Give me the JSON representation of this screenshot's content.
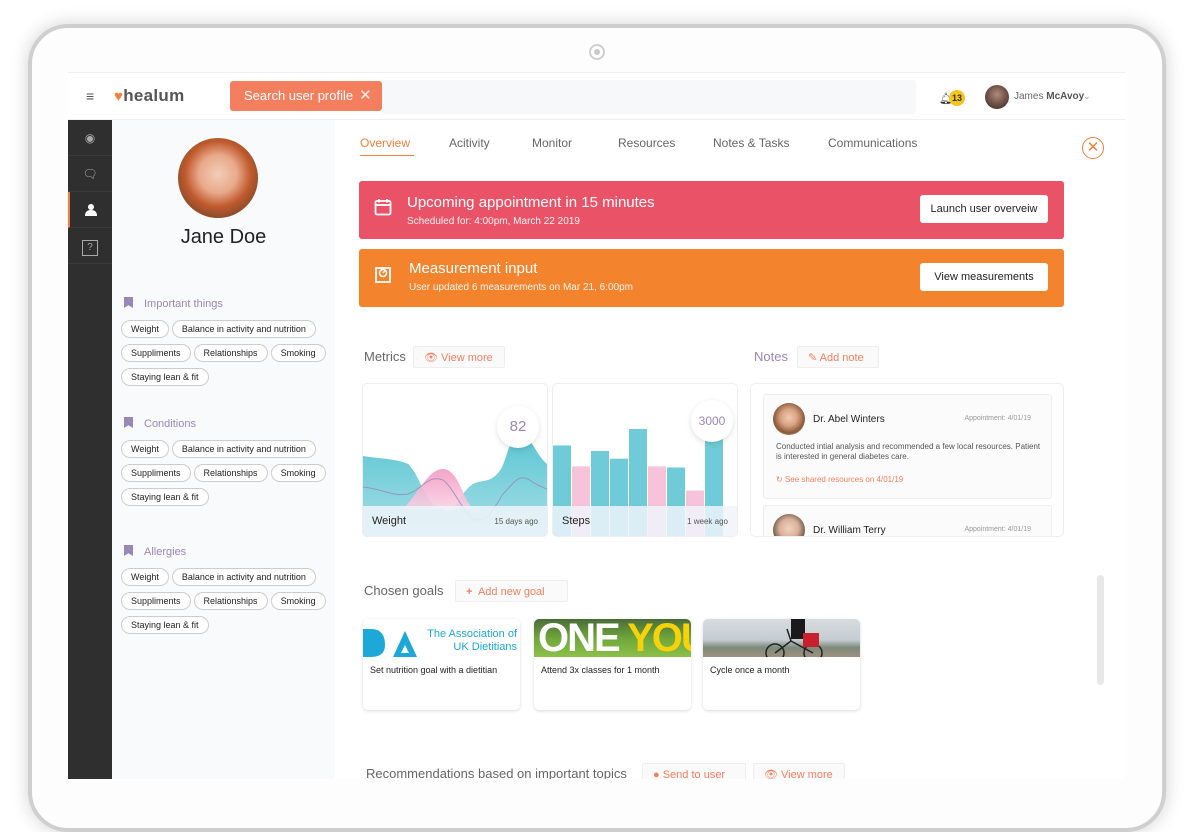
{
  "topbar": {
    "menu_icon": "hamburger-icon",
    "logo_text": "healum",
    "search_chip_label": "Search user profile",
    "search_placeholder": "",
    "notification_count": "13",
    "user_first": "James",
    "user_last": "McAvoy"
  },
  "rail": {
    "items": [
      {
        "icon": "dashboard-icon",
        "active": false
      },
      {
        "icon": "chat-icon",
        "active": false
      },
      {
        "icon": "user-icon",
        "active": true
      },
      {
        "icon": "help-icon",
        "active": false
      }
    ]
  },
  "profile": {
    "name": "Jane Doe",
    "sections": [
      {
        "title": "Important things",
        "tags": [
          "Weight",
          "Balance in activity and nutrition",
          "Suppliments",
          "Relationships",
          "Smoking",
          "Staying lean & fit"
        ]
      },
      {
        "title": "Conditions",
        "tags": [
          "Weight",
          "Balance in activity and nutrition",
          "Suppliments",
          "Relationships",
          "Smoking",
          "Staying lean & fit"
        ]
      },
      {
        "title": "Allergies",
        "tags": [
          "Weight",
          "Balance in activity and nutrition",
          "Suppliments",
          "Relationships",
          "Smoking",
          "Staying lean & fit"
        ]
      }
    ]
  },
  "tabs": [
    "Overview",
    "Acitivity",
    "Monitor",
    "Resources",
    "Notes & Tasks",
    "Communications"
  ],
  "active_tab": "Overview",
  "alerts": [
    {
      "title": "Upcoming appointment in 15 minutes",
      "subtitle": "Scheduled for: 4:00pm, March 22 2019",
      "button": "Launch user overveiw",
      "color": "#ea5367",
      "icon": "calendar-icon"
    },
    {
      "title": "Measurement input",
      "subtitle": "User updated 6 measurements on Mar 21, 6:00pm",
      "button": "View measurements",
      "color": "#f3832c",
      "icon": "scale-icon"
    }
  ],
  "metrics": {
    "label": "Metrics",
    "view_more": "View more",
    "cards": [
      {
        "name": "Weight",
        "value": "82",
        "age": "15 days ago"
      },
      {
        "name": "Steps",
        "value": "3000",
        "age": "1 week ago"
      }
    ]
  },
  "notes": {
    "label": "Notes",
    "add_label": "Add note",
    "items": [
      {
        "author": "Dr. Abel Winters",
        "appointment": "Appointment: 4/01/19",
        "body": "Conducted intial analysis and recommended a few local resources. Patient is interested in general diabetes care.",
        "link": "See shared resources on 4/01/19"
      },
      {
        "author": "Dr. William Terry",
        "appointment": "Appointment: 4/01/19"
      }
    ]
  },
  "goals": {
    "label": "Chosen goals",
    "add_label": "Add new goal",
    "items": [
      {
        "image_text": "The Association of UK Dietitians",
        "title": "Set nutrition goal with a dietitian"
      },
      {
        "image_text": "ONE YOU",
        "title": "Attend 3x classes for 1 month"
      },
      {
        "image_text": "",
        "title": "Cycle once a month"
      }
    ]
  },
  "recommendations": {
    "label": "Recommendations based on important topics",
    "send_label": "Send to user",
    "view_more": "View more"
  },
  "colors": {
    "accent": "#f0803c",
    "coral": "#f37f5f",
    "purple": "#9b86b9",
    "red": "#ea5367",
    "orange": "#f3832c",
    "teal": "#5cc6d3",
    "pink": "#f4b9d3"
  }
}
